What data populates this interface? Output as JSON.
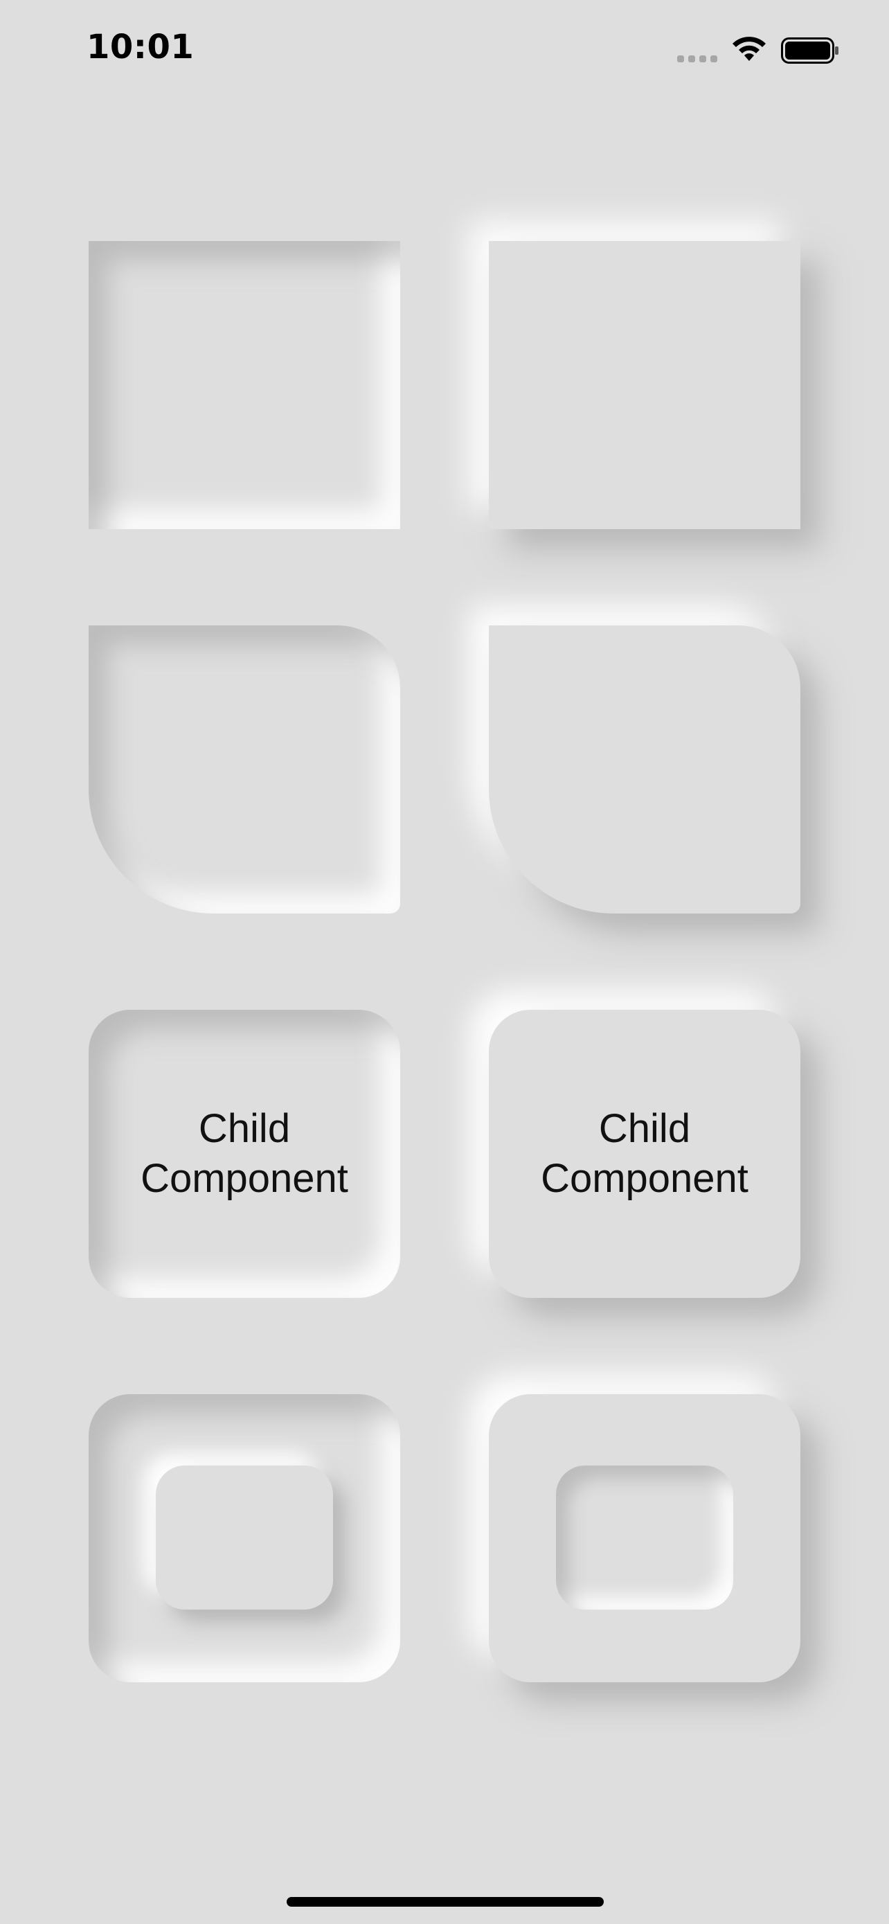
{
  "status_bar": {
    "time": "10:01",
    "signal_icon": "signal-dots-icon",
    "wifi_icon": "wifi-icon",
    "battery_icon": "battery-icon"
  },
  "cards": {
    "row3_left_label": [
      "Child",
      "Component"
    ],
    "row3_right_label": [
      "Child",
      "Component"
    ]
  },
  "home_indicator": "home-indicator"
}
